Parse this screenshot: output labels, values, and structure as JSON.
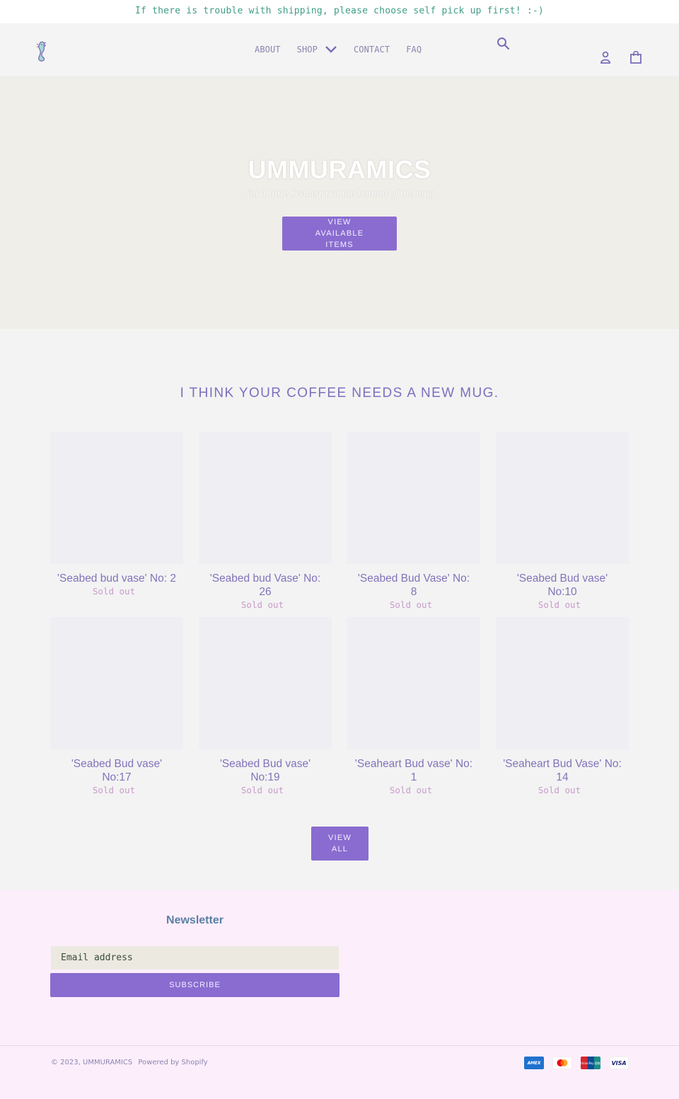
{
  "announcement": {
    "text": "If there is trouble with shipping, please choose self pick up first! :-)"
  },
  "header": {
    "logo_icon": "seahorse-logo-icon",
    "nav": [
      {
        "label": "ABOUT"
      },
      {
        "label": "SHOP",
        "has_dropdown": true
      },
      {
        "label": "CONTACT"
      },
      {
        "label": "FAQ"
      }
    ],
    "icons": [
      "search-icon",
      "account-icon",
      "cart-icon"
    ]
  },
  "hero": {
    "title": "UMMURAMICS",
    "subtitle": "I'm a little Seaheart at the bottom of the mug",
    "button_label": "VIEW AVAILABLE ITEMS"
  },
  "collection": {
    "title": "I THINK YOUR COFFEE NEEDS A NEW MUG.",
    "products": [
      {
        "title": "'Seabed bud vase' No: 2",
        "status": "Sold out"
      },
      {
        "title": "'Seabed bud Vase' No: 26",
        "status": "Sold out"
      },
      {
        "title": "'Seabed Bud Vase' No: 8",
        "status": "Sold out"
      },
      {
        "title": "'Seabed Bud vase' No:10",
        "status": "Sold out"
      },
      {
        "title": "'Seabed Bud vase' No:17",
        "status": "Sold out"
      },
      {
        "title": "'Seabed Bud vase' No:19",
        "status": "Sold out"
      },
      {
        "title": "'Seaheart Bud vase' No: 1",
        "status": "Sold out"
      },
      {
        "title": "'Seaheart Bud Vase' No: 14",
        "status": "Sold out"
      }
    ],
    "view_all_label": "VIEW ALL"
  },
  "footer": {
    "newsletter_title": "Newsletter",
    "email_placeholder": "Email address",
    "subscribe_label": "SUBSCRIBE",
    "copyright": "© 2023,",
    "brand": "UMMURAMICS",
    "powered_by": "Powered by Shopify",
    "payment_methods": [
      {
        "name": "American Express",
        "label": "AMEX"
      },
      {
        "name": "Mastercard",
        "label": ""
      },
      {
        "name": "UnionPay",
        "label": "UnionPay 银联"
      },
      {
        "name": "Visa",
        "label": "VISA"
      }
    ]
  },
  "colors": {
    "accent": "#8a6cd0",
    "heading": "#7e6fbd",
    "sold_out": "#c99bcb",
    "announcement_text": "#3f9d86",
    "footer_bg": "#fdeefc",
    "hero_bg": "#efeee9"
  }
}
